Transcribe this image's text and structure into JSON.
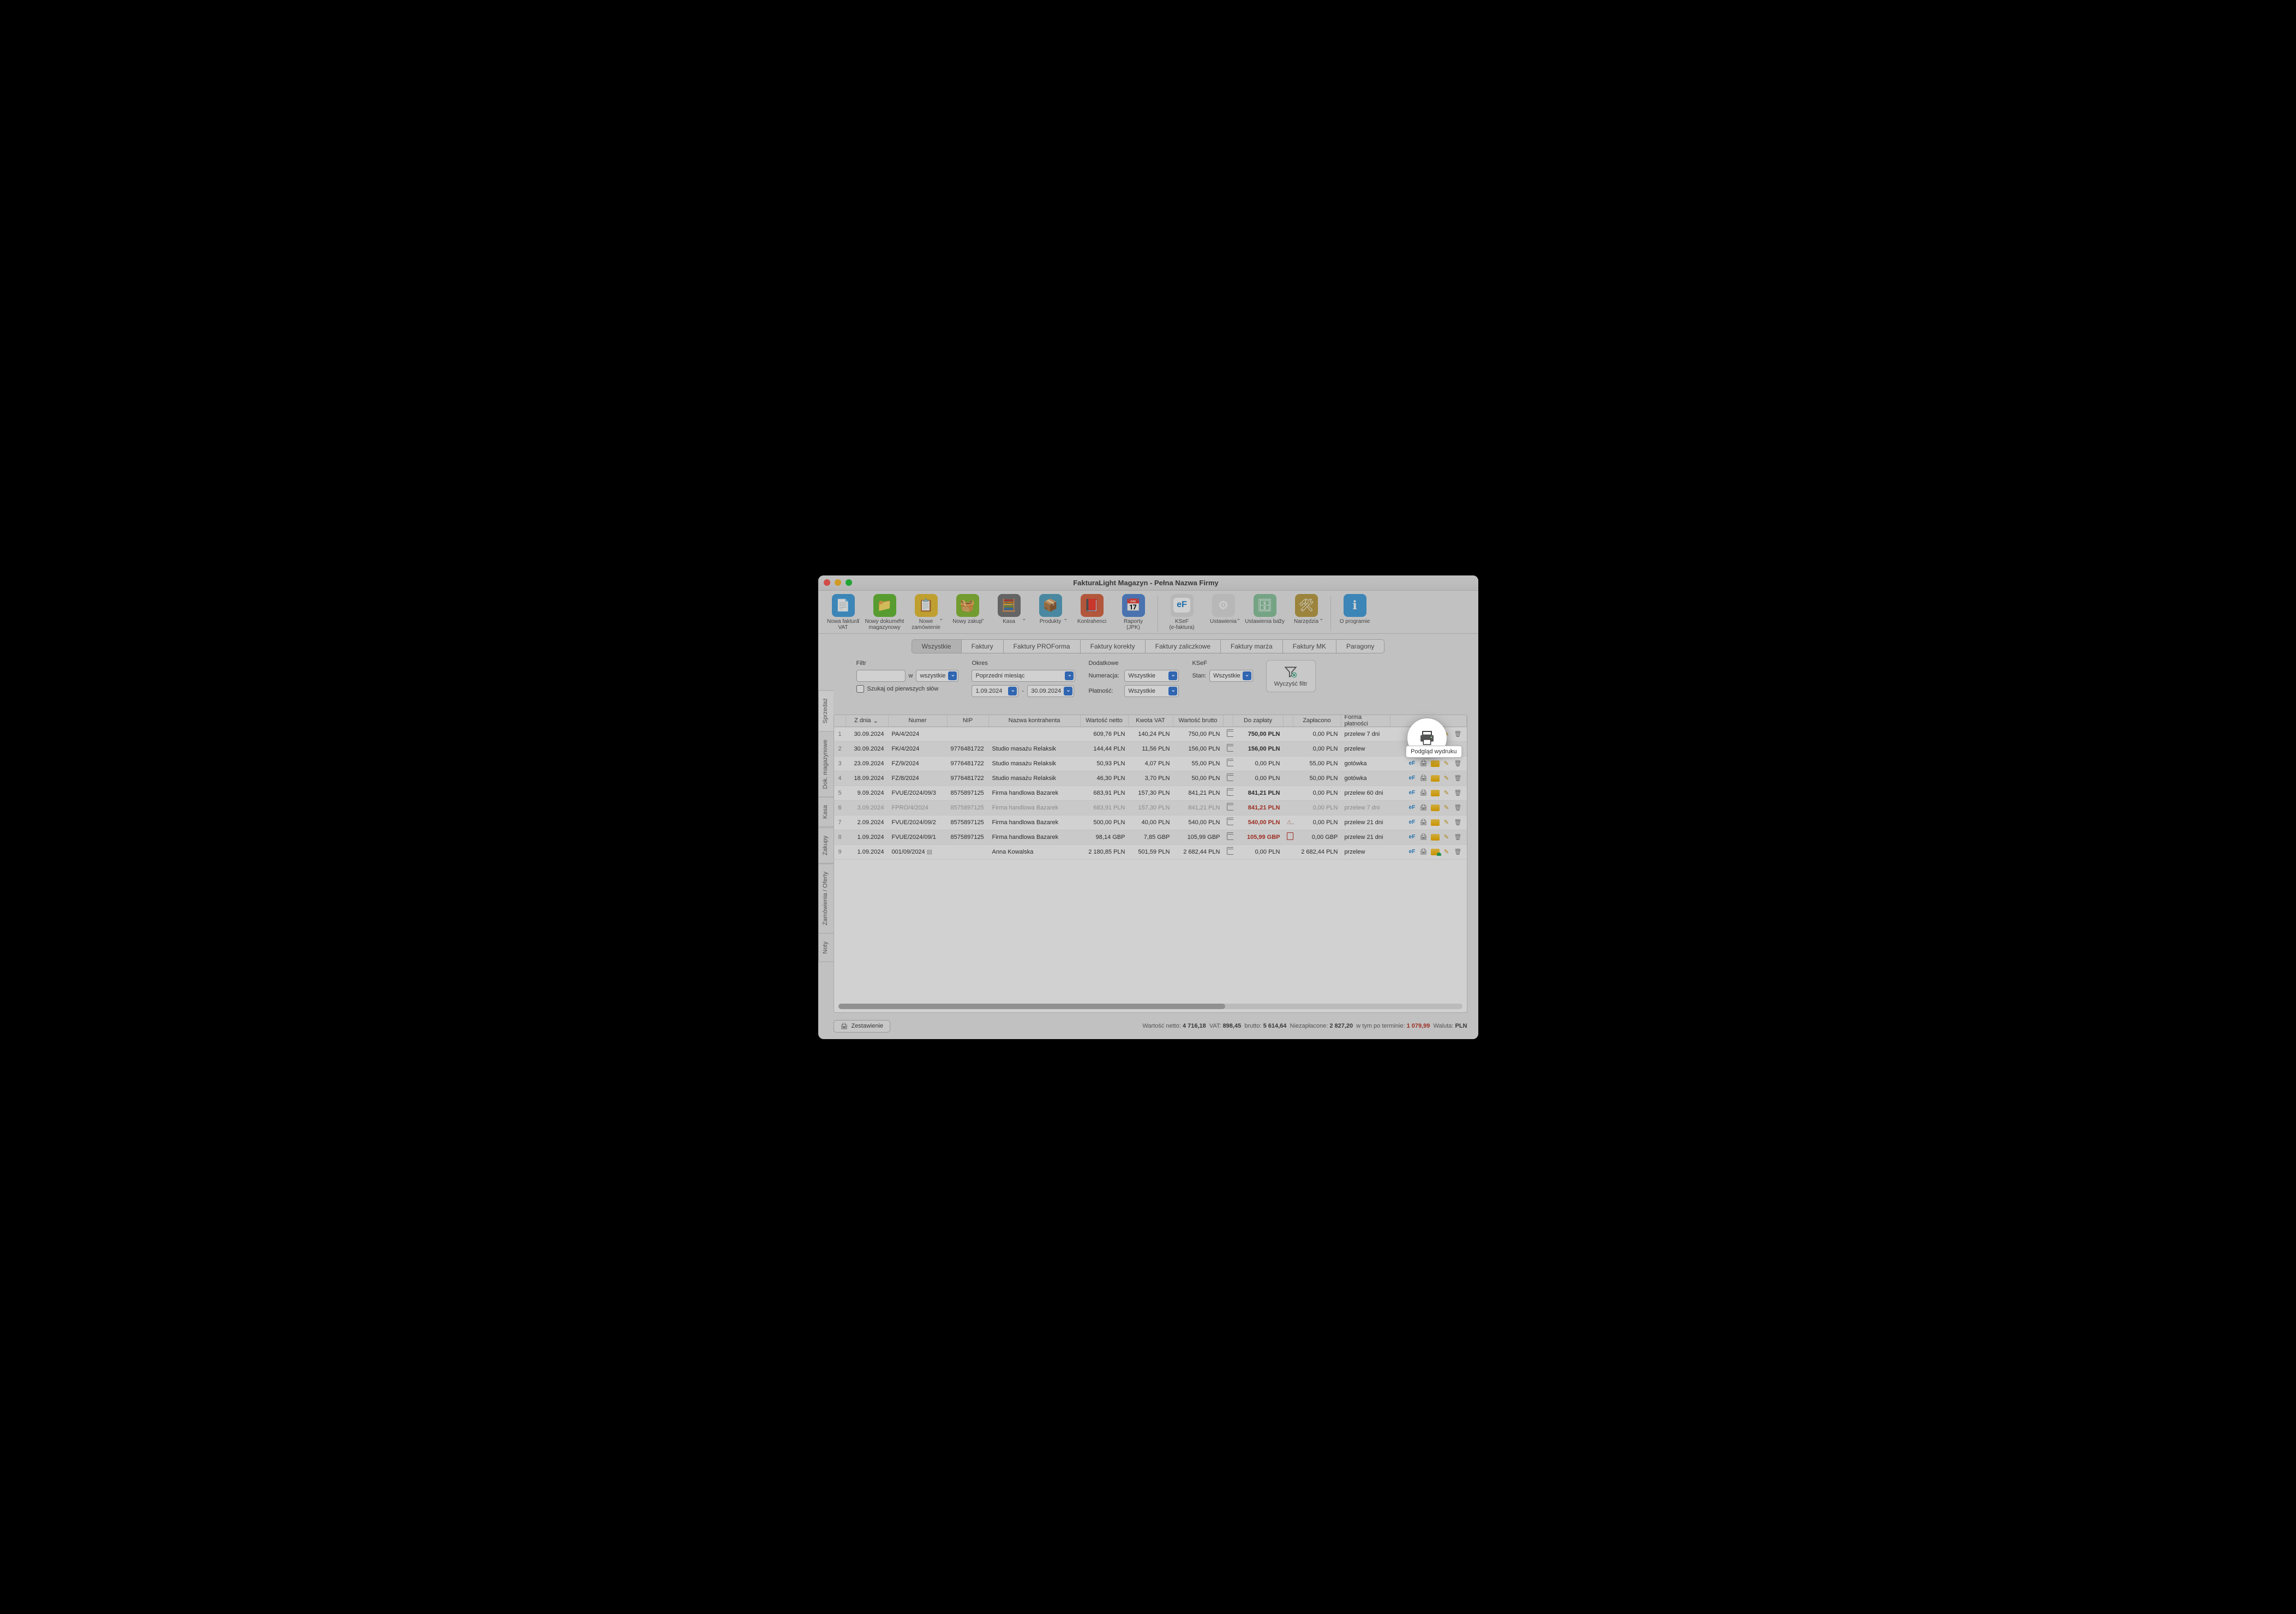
{
  "window": {
    "title": "FakturaLight Magazyn - Pełna Nazwa Firmy"
  },
  "toolbar": [
    {
      "label": "Nowa faktura\nVAT",
      "color": "#4aa3e0",
      "glyph": "📄",
      "chev": true
    },
    {
      "label": "Nowy dokument\nmagazynowy",
      "color": "#6bbf3b",
      "glyph": "📁",
      "chev": true
    },
    {
      "label": "Nowe zamówienie",
      "color": "#e9c23b",
      "glyph": "📋",
      "chev": true
    },
    {
      "label": "Nowy zakup",
      "color": "#8bbf3b",
      "glyph": "🧺",
      "chev": true
    },
    {
      "label": "Kasa",
      "color": "#7a7a7a",
      "glyph": "🧮",
      "chev": true
    },
    {
      "label": "Produkty",
      "color": "#5aa7c4",
      "glyph": "📦",
      "chev": true
    },
    {
      "label": "Kontrahenci",
      "color": "#d96b4a",
      "glyph": "📕"
    },
    {
      "label": "Raporty\n(JPK)",
      "color": "#5a8bd6",
      "glyph": "📅"
    },
    {
      "sep": true
    },
    {
      "label": "KSeF\n(e-faktura)",
      "color": "#e0e0e0",
      "glyph": "eF",
      "ef": true
    },
    {
      "label": "Ustawienia",
      "color": "#e0e0e0",
      "glyph": "⚙",
      "chev": true
    },
    {
      "label": "Ustawienia bazy",
      "color": "#8fc9a3",
      "glyph": "🗄",
      "chev": true
    },
    {
      "label": "Narzędzia",
      "color": "#bfa14a",
      "glyph": "🛠",
      "chev": true
    },
    {
      "sep": true
    },
    {
      "label": "O programie",
      "color": "#4aa3e0",
      "glyph": "ℹ"
    }
  ],
  "tabs": [
    "Wszystkie",
    "Faktury",
    "Faktury PROForma",
    "Faktury korekty",
    "Faktury zaliczkowe",
    "Faktury marża",
    "Faktury MK",
    "Paragony"
  ],
  "activeTab": 0,
  "filters": {
    "filtr_label": "Filtr",
    "w_label": "w",
    "w_value": "wszystkie",
    "search_check": "Szukaj od pierwszych słów",
    "okres_label": "Okres",
    "okres_value": "Poprzedni miesiąc",
    "date_from": "1.09.2024",
    "date_to": "30.09.2024",
    "dash": "-",
    "dodatkowe_label": "Dodatkowe",
    "numeracja_label": "Numeracja:",
    "numeracja_value": "Wszystkie",
    "platnosc_label": "Płatność:",
    "platnosc_value": "Wszystkie",
    "ksef_label": "KSeF",
    "stan_label": "Stan:",
    "stan_value": "Wszystkie",
    "clear_label": "Wyczyść filtr"
  },
  "sidetabs": [
    "Sprzedaż",
    "Dok. magazynowe",
    "Kasa",
    "Zakupy",
    "Zamówienia / Oferty",
    "Noty"
  ],
  "activeSide": 0,
  "columns": [
    "",
    "Z dnia",
    "Numer",
    "NIP",
    "Nazwa kontrahenta",
    "Wartość netto",
    "Kwota VAT",
    "Wartość brutto",
    "",
    "Do zapłaty",
    "",
    "Zapłacono",
    "Forma płatności",
    ""
  ],
  "rows": [
    {
      "n": "1",
      "date": "30.09.2024",
      "num": "PA/4/2024",
      "nip": "",
      "name": "",
      "net": "609,76 PLN",
      "vat": "140,24 PLN",
      "gross": "750,00 PLN",
      "due": "750,00 PLN",
      "dueBold": true,
      "paid": "0,00 PLN",
      "form": "przelew 7 dni",
      "selected": true
    },
    {
      "n": "2",
      "date": "30.09.2024",
      "num": "FK/4/2024",
      "nip": "9776481722",
      "name": "Studio masażu Relaksik",
      "net": "144,44 PLN",
      "vat": "11,56 PLN",
      "gross": "156,00 PLN",
      "due": "156,00 PLN",
      "dueBold": true,
      "paid": "0,00 PLN",
      "form": "przelew"
    },
    {
      "n": "3",
      "date": "23.09.2024",
      "num": "FZ/9/2024",
      "nip": "9776481722",
      "name": "Studio masażu Relaksik",
      "net": "50,93 PLN",
      "vat": "4,07 PLN",
      "gross": "55,00 PLN",
      "due": "0,00 PLN",
      "paid": "55,00 PLN",
      "form": "gotówka"
    },
    {
      "n": "4",
      "date": "18.09.2024",
      "num": "FZ/8/2024",
      "nip": "9776481722",
      "name": "Studio masażu Relaksik",
      "net": "46,30 PLN",
      "vat": "3,70 PLN",
      "gross": "50,00 PLN",
      "due": "0,00 PLN",
      "paid": "50,00 PLN",
      "form": "gotówka"
    },
    {
      "n": "5",
      "date": "9.09.2024",
      "num": "FVUE/2024/09/3",
      "nip": "8575897125",
      "name": "Firma handlowa Bazarek",
      "net": "683,91 PLN",
      "vat": "157,30 PLN",
      "gross": "841,21 PLN",
      "due": "841,21 PLN",
      "dueBold": true,
      "paid": "0,00 PLN",
      "form": "przelew 60 dni"
    },
    {
      "n": "6",
      "date": "3.09.2024",
      "num": "FPRO/4/2024",
      "nip": "8575897125",
      "name": "Firma handlowa Bazarek",
      "net": "683,91 PLN",
      "vat": "157,30 PLN",
      "gross": "841,21 PLN",
      "due": "841,21 PLN",
      "dueRed": true,
      "dueBold": true,
      "paid": "0,00 PLN",
      "form": "przelew 7 dni",
      "muted": true
    },
    {
      "n": "7",
      "date": "2.09.2024",
      "num": "FVUE/2024/09/2",
      "nip": "8575897125",
      "name": "Firma handlowa Bazarek",
      "net": "500,00 PLN",
      "vat": "40,00 PLN",
      "gross": "540,00 PLN",
      "due": "540,00 PLN",
      "dueRed": true,
      "dueBold": true,
      "paid": "0,00 PLN",
      "form": "przelew 21 dni",
      "warn": true
    },
    {
      "n": "8",
      "date": "1.09.2024",
      "num": "FVUE/2024/09/1",
      "nip": "8575897125",
      "name": "Firma handlowa Bazarek",
      "net": "98,14 GBP",
      "vat": "7,85 GBP",
      "gross": "105,99 GBP",
      "due": "105,99 GBP",
      "dueRed": true,
      "dueBold": true,
      "paid": "0,00 GBP",
      "form": "przelew 21 dni",
      "pdf": true
    },
    {
      "n": "9",
      "date": "1.09.2024",
      "num": "001/09/2024",
      "nip": "",
      "name": "Anna Kowalska",
      "net": "2 180,85 PLN",
      "vat": "501,59 PLN",
      "gross": "2 682,44 PLN",
      "due": "0,00 PLN",
      "paid": "2 682,44 PLN",
      "form": "przelew",
      "envGreen": true,
      "noteIcon": true
    }
  ],
  "footer": {
    "zestawienie": "Zestawienie",
    "net_k": "Wartość netto:",
    "net_v": "4 716,18",
    "vat_k": "VAT:",
    "vat_v": "898,45",
    "gross_k": "brutto:",
    "gross_v": "5 614,64",
    "unpaid_k": "Niezapłacone:",
    "unpaid_v": "2 827,20",
    "after_k": "w tym po terminie:",
    "after_v": "1 079,99",
    "cur_k": "Waluta:",
    "cur_v": "PLN"
  },
  "tooltip": "Podgląd wydruku"
}
